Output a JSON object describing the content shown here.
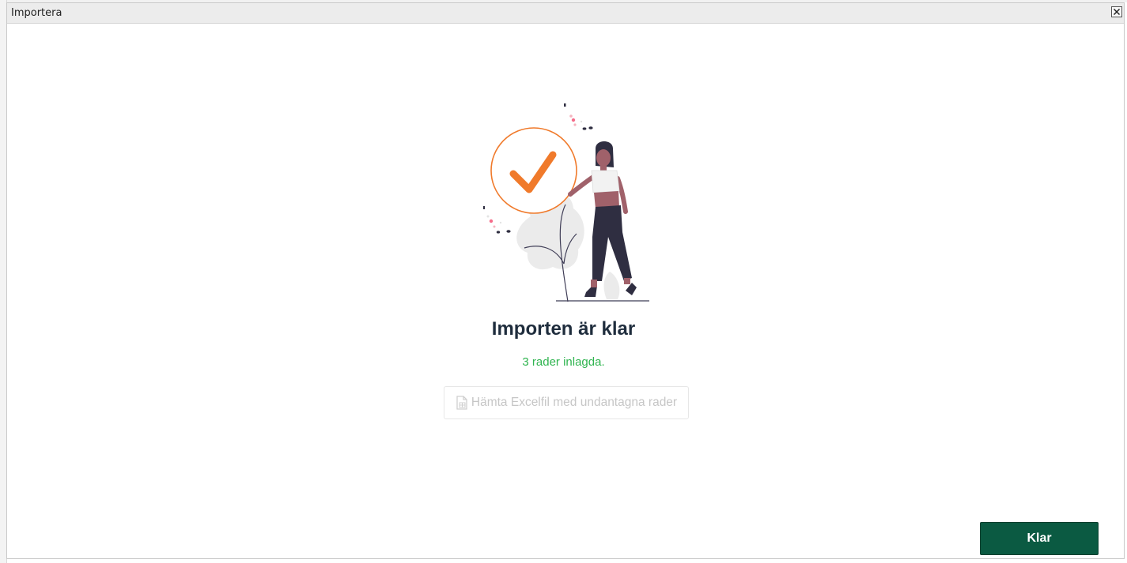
{
  "dialog": {
    "title": "Importera",
    "close_icon": "close-icon"
  },
  "result": {
    "heading": "Importen är klar",
    "message": "3 rader inlagda.",
    "illustration": "success-illustration",
    "check_color": "#f07a2b",
    "message_color": "#2fb44f"
  },
  "download": {
    "label": "Hämta Excelfil med undantagna rader",
    "icon": "excel-file-icon",
    "enabled": false
  },
  "footer": {
    "done_label": "Klar",
    "done_color": "#0b5a42"
  }
}
